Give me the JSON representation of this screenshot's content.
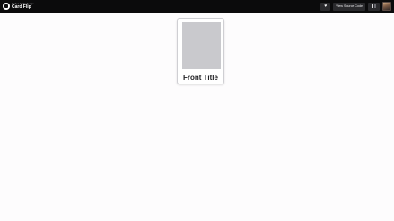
{
  "header": {
    "subtitle": "Daily UI Challenge",
    "title": "Card Flip",
    "heart_icon": "♥",
    "source_button_label": "View Source Code"
  },
  "card": {
    "front_title": "Front Title"
  },
  "icons": {
    "logo": "logo-icon",
    "heart": "heart-icon",
    "menu": "menu-icon"
  },
  "colors": {
    "topbar": "#0b0b0c",
    "page_background": "#fdfcfd",
    "card_image_placeholder": "#c9c9cd"
  }
}
